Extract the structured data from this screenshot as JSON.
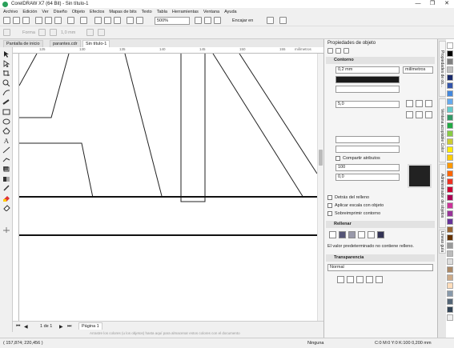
{
  "window": {
    "title": "CorelDRAW X7 (64 Bit) - Sin título-1",
    "controls": [
      "—",
      "❐",
      "✕"
    ]
  },
  "menu": [
    "Archivo",
    "Edición",
    "Ver",
    "Diseño",
    "Objeto",
    "Efectos",
    "Mapas de bits",
    "Texto",
    "Tabla",
    "Herramientas",
    "Ventana",
    "Ayuda"
  ],
  "toolbar": {
    "zoom": "500%",
    "snap": "Encajar en"
  },
  "propbar": {
    "shape_label": "Forma",
    "outline_width": "1,0 mm"
  },
  "tabs": [
    "Pantalla de inicio",
    "parantes.cdr",
    "Sin título-1"
  ],
  "ruler": {
    "units": "milímetros",
    "ticks": [
      "125",
      "130",
      "135",
      "140",
      "145",
      "150",
      "155"
    ]
  },
  "pagebar": {
    "count": "1 de 1",
    "page_tab": "Página 1",
    "hint": "Arrastre los colores (u los objetos) hasta aquí para almacenar estos colores con el documento"
  },
  "status": {
    "coords": "( 157,874; 220,456 )",
    "fill": "Ninguna",
    "outline": "C:0 M:0 Y:0 K:100  0,200 mm"
  },
  "docker": {
    "title": "Propiedades de objeto",
    "outline": {
      "header": "Contorno",
      "width": "0,2 mm",
      "units": "milímetros",
      "miter": "5,0",
      "behind_fill": "Detrás del relleno",
      "scale_with": "Aplicar escala con objeto",
      "overprint": "Sobreimprimir contorno",
      "calligraphic": "Caligráfico",
      "stretch": "100",
      "angle": "0,0",
      "share_attrs": "Compartir atributos"
    },
    "fill": {
      "header": "Rellenar",
      "message": "El valor predeterminado no contiene relleno."
    },
    "transparency": {
      "header": "Transparencia",
      "mode": "Normal"
    }
  },
  "side_tabs": [
    "Propiedades de ob...",
    "Ventana acoplable Color",
    "Administrador de objetos",
    "Líneas guía"
  ],
  "palette_colors": [
    "#ffffff",
    "#000000",
    "#808080",
    "#c0c0c0",
    "#1a2a6c",
    "#3355aa",
    "#4488dd",
    "#66aaee",
    "#66cccc",
    "#339966",
    "#22aa44",
    "#88cc44",
    "#cccc33",
    "#ffee00",
    "#ffcc00",
    "#ff9900",
    "#ff6600",
    "#ee3322",
    "#cc0033",
    "#aa0055",
    "#cc3399",
    "#993399",
    "#663399",
    "#996633",
    "#663300",
    "#999999",
    "#bbbbbb",
    "#dddddd",
    "#aa8866",
    "#ccaa88",
    "#ffddbb",
    "#8899aa",
    "#556677",
    "#334455",
    "#eeeeee"
  ]
}
